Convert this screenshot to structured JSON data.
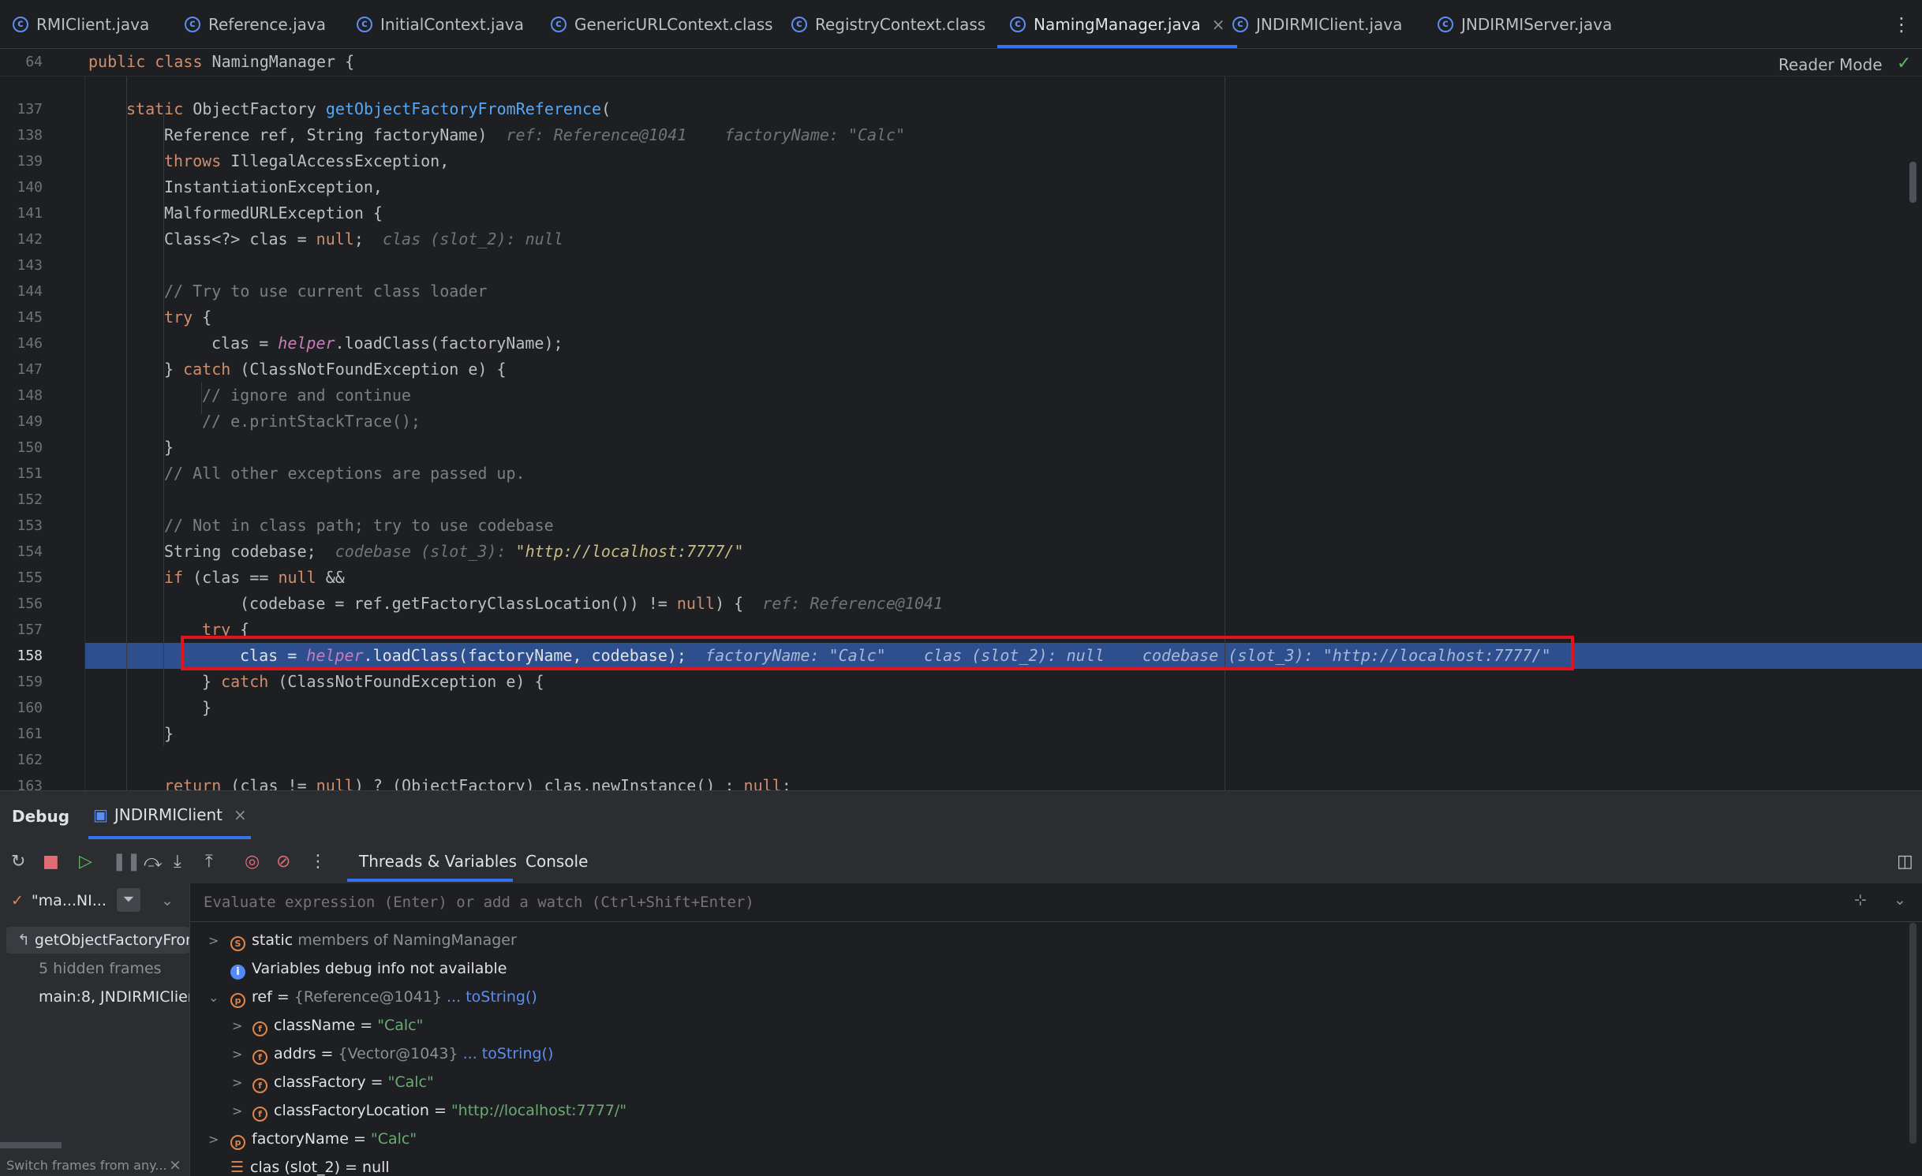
{
  "tabs": [
    {
      "label": "RMIClient.java"
    },
    {
      "label": "Reference.java"
    },
    {
      "label": "InitialContext.java"
    },
    {
      "label": "GenericURLContext.class"
    },
    {
      "label": "RegistryContext.class"
    },
    {
      "label": "NamingManager.java",
      "active": true
    },
    {
      "label": "JNDIRMIClient.java"
    },
    {
      "label": "JNDIRMIServer.java"
    }
  ],
  "editor": {
    "sticky_line_no": "64",
    "sticky_line_kw": "public class",
    "sticky_line_name": " NamingManager {",
    "reader_mode": "Reader Mode",
    "lines": [
      {
        "n": "137"
      },
      {
        "n": "138"
      },
      {
        "n": "139"
      },
      {
        "n": "140"
      },
      {
        "n": "141"
      },
      {
        "n": "142"
      },
      {
        "n": "143"
      },
      {
        "n": "144"
      },
      {
        "n": "145"
      },
      {
        "n": "146"
      },
      {
        "n": "147"
      },
      {
        "n": "148"
      },
      {
        "n": "149"
      },
      {
        "n": "150"
      },
      {
        "n": "151"
      },
      {
        "n": "152"
      },
      {
        "n": "153"
      },
      {
        "n": "154"
      },
      {
        "n": "155"
      },
      {
        "n": "156"
      },
      {
        "n": "157"
      },
      {
        "n": "158"
      },
      {
        "n": "159"
      },
      {
        "n": "160"
      },
      {
        "n": "161"
      },
      {
        "n": "162"
      },
      {
        "n": "163"
      }
    ],
    "code": {
      "l137_kw": "static",
      "l137_type": " ObjectFactory ",
      "l137_fn": "getObjectFactoryFromReference",
      "l137_end": "(",
      "l138": "Reference ref, String factoryName)",
      "l138_hint": "ref: Reference@1041    factoryName: \"Calc\"",
      "l139_kw": "throws",
      "l139": " IllegalAccessException,",
      "l140": "InstantiationException,",
      "l141": "MalformedURLException {",
      "l142_a": "Class<?> clas = ",
      "l142_kw": "null",
      "l142_b": ";",
      "l142_hint": "clas (slot_2): null",
      "l144": "// Try to use current class loader",
      "l145_kw": "try",
      "l145": " {",
      "l146_a": "clas = ",
      "l146_it": "helper",
      "l146_b": ".loadClass(factoryName);",
      "l147_a": "} ",
      "l147_kw": "catch",
      "l147_b": " (ClassNotFoundException e) {",
      "l148": "// ignore and continue",
      "l149": "// e.printStackTrace();",
      "l150": "}",
      "l151": "// All other exceptions are passed up.",
      "l153": "// Not in class path; try to use codebase",
      "l154": "String codebase;",
      "l154_hint": "codebase (slot_3): ",
      "l154_hstr": "\"http://localhost:7777/\"",
      "l155_kw": "if",
      "l155_a": " (clas == ",
      "l155_kw2": "null",
      "l155_b": " &&",
      "l156_a": "(codebase = ref.getFactoryClassLocation()) != ",
      "l156_kw": "null",
      "l156_b": ") {",
      "l156_hint": "ref: Reference@1041",
      "l157_kw": "try",
      "l157": " {",
      "l158_a": "clas = ",
      "l158_it": "helper",
      "l158_b": ".loadClass(factoryName, codebase);",
      "l158_hint": "factoryName: \"Calc\"    clas (slot_2): null    codebase (slot_3): \"http://localhost:7777/\"",
      "l159_a": "} ",
      "l159_kw": "catch",
      "l159_b": " (ClassNotFoundException e) {",
      "l160": "}",
      "l161": "}",
      "l163_kw": "return",
      "l163_a": " (clas != ",
      "l163_kw2": "null",
      "l163_b": ") ? (ObjectFactory) clas.newInstance() : ",
      "l163_kw3": "null",
      "l163_c": ";"
    }
  },
  "debug": {
    "title": "Debug",
    "session": "JNDIRMIClient",
    "tab_threads": "Threads & Variables",
    "tab_console": "Console",
    "thread_label": "\"ma...NI...",
    "eval_placeholder": "Evaluate expression (Enter) or add a watch (Ctrl+Shift+Enter)",
    "frames": [
      {
        "label": "getObjectFactoryFrom"
      },
      {
        "label": "5 hidden frames"
      },
      {
        "label": "main:8, JNDIRMIClient"
      }
    ],
    "switch_frames": "Switch frames from any...",
    "vars": {
      "static": "static",
      "static_rest": " members of NamingManager",
      "info": "Variables debug info not available",
      "ref_name": "ref",
      "ref_eq": " = ",
      "ref_val": "{Reference@1041}",
      "ref_link": "... toString()",
      "className_name": "className",
      "className_val": "\"Calc\"",
      "addrs_name": "addrs",
      "addrs_val": "{Vector@1043}",
      "addrs_link": "... toString()",
      "classFactory_name": "classFactory",
      "classFactory_val": "\"Calc\"",
      "classFactoryLocation_name": "classFactoryLocation",
      "classFactoryLocation_val": "\"http://localhost:7777/\"",
      "factoryName_name": "factoryName",
      "factoryName_val": "\"Calc\"",
      "clas_name": "clas (slot_2)",
      "clas_val": "null",
      "eq": " = "
    }
  }
}
